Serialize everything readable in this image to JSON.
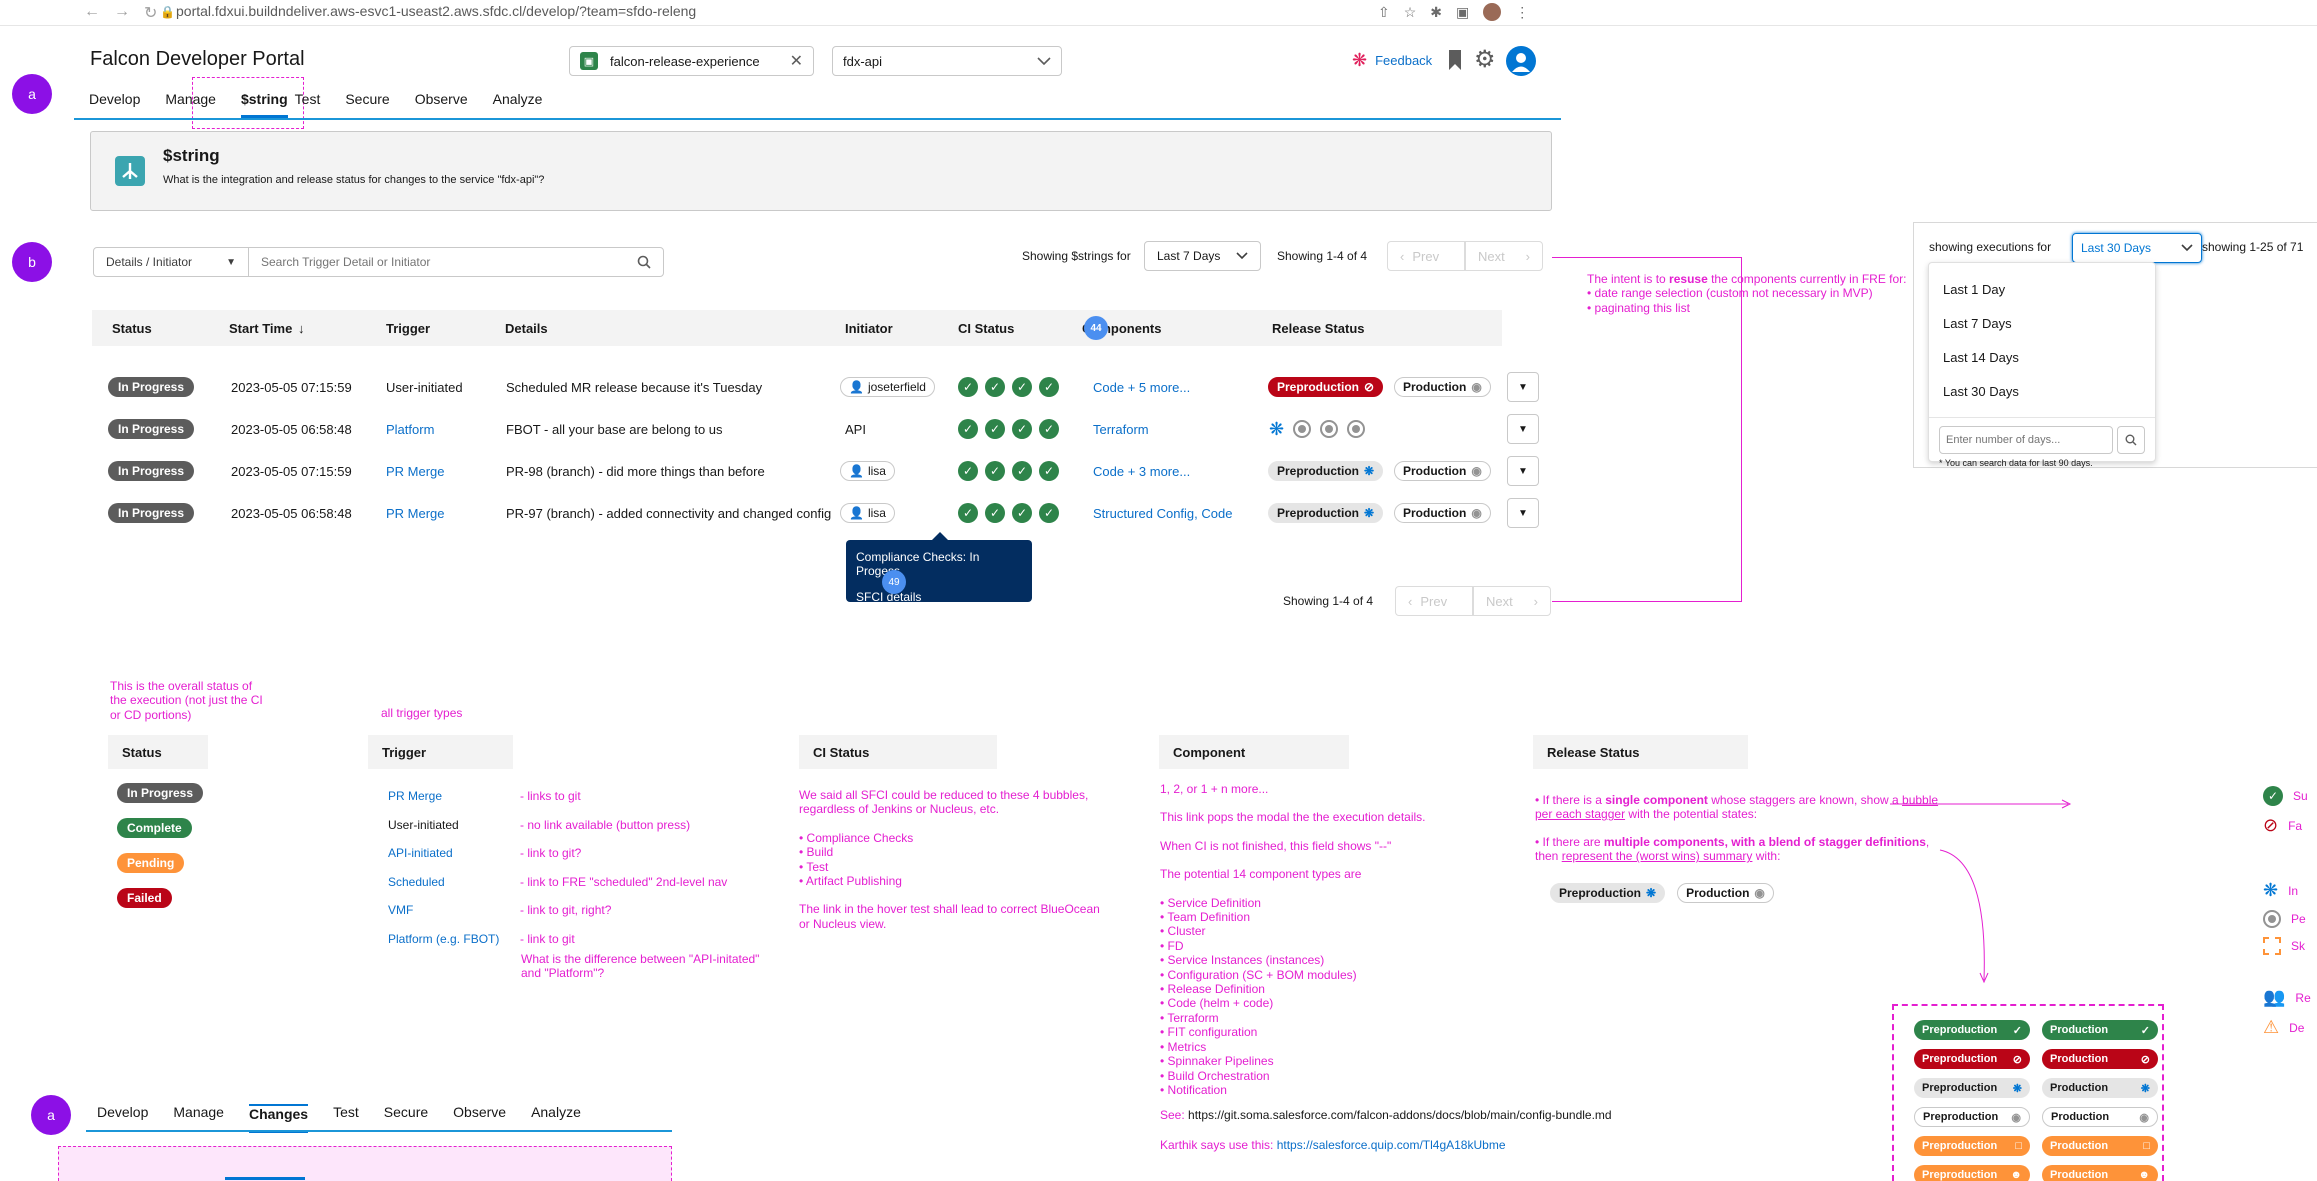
{
  "browser": {
    "url": "portal.fdxui.buildndeliver.aws-esvc1-useast2.aws.sfdc.cl/develop/?team=sfdo-releng"
  },
  "header": {
    "title": "Falcon Developer Portal",
    "team_selector": "falcon-release-experience",
    "service_selector": "fdx-api",
    "feedback_label": "Feedback"
  },
  "markers": {
    "a": "a",
    "b": "b"
  },
  "tabs": [
    "Develop",
    "Manage",
    "$string",
    "Test",
    "Secure",
    "Observe",
    "Analyze"
  ],
  "service_card": {
    "title": "$string",
    "subtitle": "What is the integration and release status for changes to the service \"fdx-api\"?"
  },
  "toolbar": {
    "filter_label": "Details / Initiator",
    "search_placeholder": "Search Trigger Detail or Initiator",
    "showing_for_label": "Showing $strings for",
    "date_range": "Last 7 Days",
    "showing_count": "Showing 1-4 of 4",
    "prev_label": "Prev",
    "next_label": "Next"
  },
  "table": {
    "columns": [
      "Status",
      "Start Time",
      "Trigger",
      "Details",
      "Initiator",
      "CI Status",
      "Components",
      "Release Status"
    ],
    "column_bubble": "44",
    "rows": [
      {
        "status": "In Progress",
        "start": "2023-05-05 07:15:59",
        "trigger": "User-initiated",
        "details": "Scheduled MR release because it's Tuesday",
        "initiator": "joseterfield",
        "components": "Code + 5 more..."
      },
      {
        "status": "In Progress",
        "start": "2023-05-05 06:58:48",
        "trigger": "Platform",
        "details": "FBOT - all your base are belong to us",
        "initiator": "API",
        "components": "Terraform"
      },
      {
        "status": "In Progress",
        "start": "2023-05-05 07:15:59",
        "trigger": "PR Merge",
        "details": "PR-98 (branch) - did more things than before",
        "initiator": "lisa",
        "components": "Code + 3 more..."
      },
      {
        "status": "In Progress",
        "start": "2023-05-05 06:58:48",
        "trigger": "PR Merge",
        "details": "PR-97 (branch) - added connectivity and changed config",
        "initiator": "lisa",
        "components": "Structured Config, Code"
      }
    ],
    "release": {
      "preproduction": "Preproduction",
      "production": "Production"
    },
    "bottom_showing": "Showing 1-4 of 4"
  },
  "tooltip": {
    "text": "Compliance Checks: In Progess",
    "link": "SFCI details",
    "bubble": "49"
  },
  "annotation_top": {
    "line1_pre": "The intent is to ",
    "line1_bold": "resuse",
    "line1_post": " the components currently in FRE for:",
    "bullet1": "• date range selection (custom not necessary in MVP)",
    "bullet2": "• paginating this list"
  },
  "dropdown": {
    "label": "showing executions for",
    "selected": "Last 30 Days",
    "count": "showing 1-25 of 71",
    "options": [
      "Last 1 Day",
      "Last 7 Days",
      "Last 14 Days",
      "Last 30 Days"
    ],
    "input_placeholder": "Enter number of days...",
    "hint": "* You can search data for last 90 days."
  },
  "legend": {
    "status_note": "This is the overall status of the execution (not just the CI or CD portions)",
    "status_head": "Status",
    "statuses": [
      "In Progress",
      "Complete",
      "Pending",
      "Failed"
    ],
    "trigger_note": "all trigger types",
    "trigger_head": "Trigger",
    "triggers": [
      {
        "name": "PR Merge",
        "note": "- links to git",
        "linked": true
      },
      {
        "name": "User-initiated",
        "note": "- no link available (button press)",
        "linked": false
      },
      {
        "name": "API-initiated",
        "note": "- link to git?",
        "linked": true
      },
      {
        "name": "Scheduled",
        "note": "- link to FRE \"scheduled\" 2nd-level nav",
        "linked": true
      },
      {
        "name": "VMF",
        "note": "- link to git, right?",
        "linked": true
      },
      {
        "name": "Platform (e.g. FBOT)",
        "note": "- link to git",
        "linked": true
      }
    ],
    "trigger_question": "What is the difference between \"API-initated\" and \"Platform\"?",
    "ci_head": "CI Status",
    "ci_notes": [
      "We said all SFCI could be reduced to these 4 bubbles, regardless of Jenkins or Nucleus, etc.",
      "• Compliance Checks",
      "• Build",
      "• Test",
      "• Artifact Publishing",
      "The link in the hover test shall lead to correct BlueOcean or Nucleus view."
    ],
    "component_head": "Component",
    "component_notes": [
      "1, 2, or 1 + n more...",
      "This link pops the modal the the execution details.",
      "When CI is not finished, this field shows \"--\"",
      "The potential 14 component types are"
    ],
    "component_types": [
      "• Service Definition",
      "• Team Definition",
      "• Cluster",
      "• FD",
      "• Service Instances (instances)",
      "• Configuration (SC + BOM modules)",
      "• Release Definition",
      "• Code (helm + code)",
      "• Terraform",
      "• FIT configuration",
      "• Metrics",
      "• Spinnaker Pipelines",
      "• Build Orchestration",
      "• Notification"
    ],
    "see_label": "See: ",
    "see_url": "https://git.soma.salesforce.com/falcon-addons/docs/blob/main/config-bundle.md",
    "karthik_label": "Karthik says use this: ",
    "karthik_url": "https://salesforce.quip.com/Tl4gA18kUbme",
    "release_head": "Release Status",
    "release_note1_pre": "• If there is a ",
    "release_note1_bold": "single component",
    "release_note1_post": " whose staggers are known, show a ",
    "release_note1_u": "bubble per each stagger",
    "release_note1_end": " with the potential states:",
    "release_note2_pre": "• If there are ",
    "release_note2_bold": "multiple components, with a blend of stagger definitions",
    "release_note2_post": ", then ",
    "release_note2_u": "represent the (worst wins) summary",
    "release_note2_end": " with:",
    "state_labels": [
      "Su",
      "Fa",
      "In",
      "Pe",
      "Sk",
      "Re",
      "De"
    ]
  },
  "bottom_nav": {
    "tabs": [
      "Develop",
      "Manage",
      "Changes",
      "Test",
      "Secure",
      "Observe",
      "Analyze"
    ]
  },
  "colors": {
    "accent": "#0176d3",
    "marker": "#8c10e6",
    "annotation": "#e41fd0",
    "success": "#2e844a",
    "failed": "#ba0517",
    "pending": "#fe9339",
    "in_progress": "#5c5c5c"
  }
}
